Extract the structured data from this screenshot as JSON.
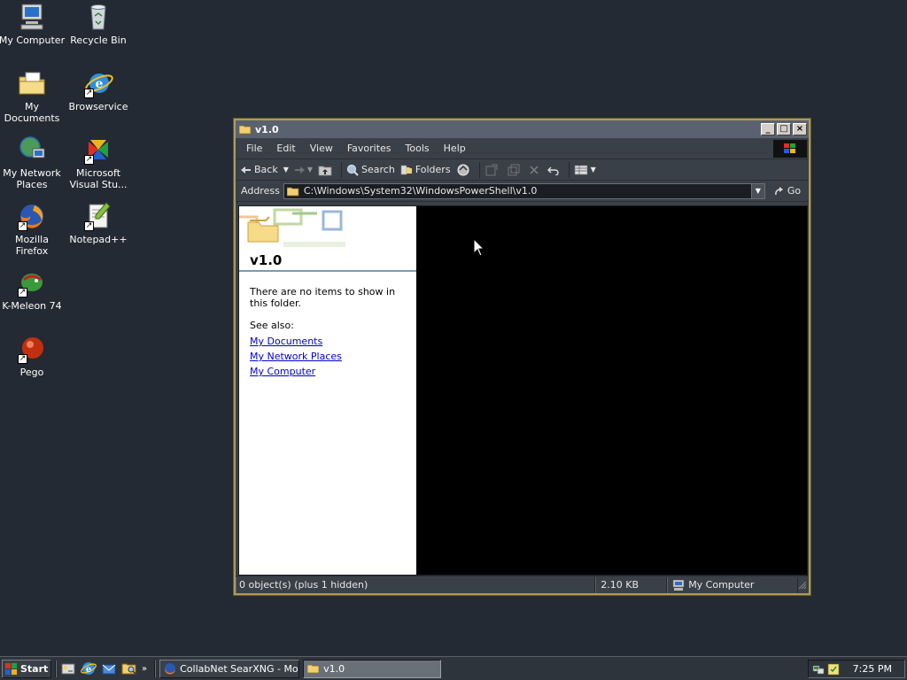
{
  "desktop": {
    "icons": [
      {
        "label": "My Computer",
        "icon": "computer-icon"
      },
      {
        "label": "Recycle Bin",
        "icon": "recycle-bin-icon"
      },
      {
        "label": "My Documents",
        "icon": "my-documents-icon"
      },
      {
        "label": "Browservice",
        "icon": "internet-explorer-icon"
      },
      {
        "label": "My Network Places",
        "icon": "network-places-icon"
      },
      {
        "label": "Microsoft Visual Stu...",
        "icon": "visual-studio-icon"
      },
      {
        "label": "Mozilla Firefox",
        "icon": "firefox-icon"
      },
      {
        "label": "Notepad++",
        "icon": "notepad-plus-plus-icon"
      },
      {
        "label": "K-Meleon 74",
        "icon": "k-meleon-icon"
      },
      {
        "label": "Pego",
        "icon": "pego-icon"
      }
    ]
  },
  "window": {
    "title": "v1.0",
    "menu": [
      "File",
      "Edit",
      "View",
      "Favorites",
      "Tools",
      "Help"
    ],
    "toolbar": {
      "back": "Back",
      "search": "Search",
      "folders": "Folders"
    },
    "address": {
      "label": "Address",
      "value": "C:\\Windows\\System32\\WindowsPowerShell\\v1.0",
      "go": "Go"
    },
    "taskpane": {
      "title": "v1.0",
      "empty_message": "There are no items to show in this folder.",
      "see_also": "See also:",
      "links": [
        "My Documents",
        "My Network Places",
        "My Computer"
      ]
    },
    "status": {
      "objects": "0 object(s) (plus 1 hidden)",
      "size": "2.10 KB",
      "location": "My Computer"
    }
  },
  "taskbar": {
    "start": "Start",
    "tasks": [
      {
        "label": "CollabNet SearXNG - Mozil...",
        "active": false
      },
      {
        "label": "v1.0",
        "active": true
      }
    ],
    "clock": "7:25 PM",
    "more": "»"
  }
}
